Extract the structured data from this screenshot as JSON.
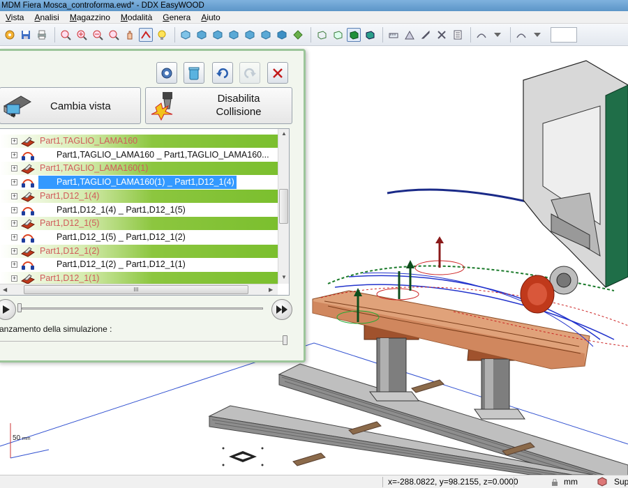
{
  "window": {
    "title": "MDM Fiera Mosca_controforma.ewd* - DDX EasyWOOD"
  },
  "menu": [
    {
      "first": "V",
      "rest": "ista"
    },
    {
      "first": "A",
      "rest": "nalisi"
    },
    {
      "first": "M",
      "rest": "agazzino"
    },
    {
      "first": "M",
      "rest": "odalità"
    },
    {
      "first": "G",
      "rest": "enera"
    },
    {
      "first": "A",
      "rest": "iuto"
    }
  ],
  "toolbar": {
    "icons": [
      "settings-icon",
      "save-icon",
      "print-icon",
      "zoom-window-icon",
      "zoom-in-icon",
      "zoom-out-icon",
      "zoom-all-icon",
      "pan-icon",
      "path-icon",
      "light-icon",
      "view-iso-icon",
      "view-front-icon",
      "view-back-icon",
      "view-left-icon",
      "view-right-icon",
      "view-top-icon",
      "view-bottom-icon",
      "wireframe-icon",
      "hidden-line-icon",
      "shaded-icon",
      "shaded-edges-icon",
      "measure-icon",
      "machine-icon",
      "tool-icon",
      "checklist-icon",
      "section-icon",
      "section-2-icon"
    ]
  },
  "sim_panel": {
    "buttons": {
      "settings": "settings-icon",
      "recycle": "recycle-bin-icon",
      "undo": "undo-icon",
      "redo": "redo-icon",
      "close": "close-icon"
    },
    "change_view_label": "Cambia vista",
    "collision_line1": "Disabilita",
    "collision_line2": "Collisione",
    "tree": [
      {
        "type": "header",
        "label": "Part1,TAGLIO_LAMA160"
      },
      {
        "type": "child",
        "label": "Part1,TAGLIO_LAMA160 _ Part1,TAGLIO_LAMA160...",
        "selected": false
      },
      {
        "type": "header",
        "label": "Part1,TAGLIO_LAMA160(1)"
      },
      {
        "type": "child",
        "label": "Part1,TAGLIO_LAMA160(1) _ Part1,D12_1(4)",
        "selected": true
      },
      {
        "type": "header",
        "label": "Part1,D12_1(4)"
      },
      {
        "type": "child",
        "label": "Part1,D12_1(4) _ Part1,D12_1(5)",
        "selected": false
      },
      {
        "type": "header",
        "label": "Part1,D12_1(5)"
      },
      {
        "type": "child",
        "label": "Part1,D12_1(5) _ Part1,D12_1(2)",
        "selected": false
      },
      {
        "type": "header",
        "label": "Part1,D12_1(2)"
      },
      {
        "type": "child",
        "label": "Part1,D12_1(2) _ Part1,D12_1(1)",
        "selected": false
      },
      {
        "type": "header",
        "label": "Part1,D12_1(1)"
      }
    ],
    "hscroll_grip": "III",
    "speed_label": "anzamento della simulazione :",
    "timeline_progress": 0.0,
    "speed_level": 1.0
  },
  "viewport": {
    "scale_label": "50",
    "scale_unit": "mm"
  },
  "status": {
    "coords": "x=-288.0822, y=98.2155, z=0.0000",
    "units": "mm",
    "view_mode": "Sup"
  }
}
